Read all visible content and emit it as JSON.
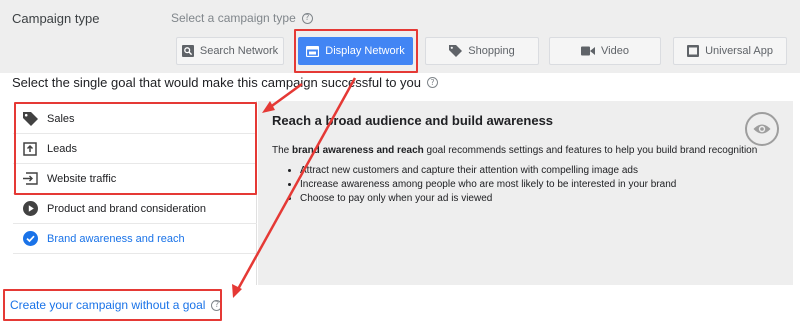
{
  "header": {
    "campaign_type_label": "Campaign type",
    "select_prompt": "Select a campaign type",
    "help_glyph": "?"
  },
  "tabs": [
    {
      "label": "Search Network",
      "icon": "search-icon"
    },
    {
      "label": "Display Network",
      "icon": "display-icon",
      "active": true
    },
    {
      "label": "Shopping",
      "icon": "tag-icon"
    },
    {
      "label": "Video",
      "icon": "video-icon"
    },
    {
      "label": "Universal App",
      "icon": "app-icon"
    }
  ],
  "goal_prompt": "Select the single goal that would make this campaign successful to you",
  "goals": [
    {
      "label": "Sales",
      "icon": "tag-icon"
    },
    {
      "label": "Leads",
      "icon": "leads-icon"
    },
    {
      "label": "Website traffic",
      "icon": "website-traffic-icon"
    },
    {
      "label": "Product and brand consideration",
      "icon": "play-icon"
    },
    {
      "label": "Brand awareness and reach",
      "icon": "check-circle-icon",
      "selected": true
    }
  ],
  "detail": {
    "title": "Reach a broad audience and build awareness",
    "desc_prefix": "The ",
    "desc_bold": "brand awareness and reach",
    "desc_suffix": " goal recommends settings and features to help you build brand recognition",
    "bullets": [
      "Attract new customers and capture their attention with compelling image ads",
      "Increase awareness among people who are most likely to be interested in your brand",
      "Choose to pay only when your ad is viewed"
    ],
    "icon": "eye-icon"
  },
  "no_goal_link": "Create your campaign without a goal",
  "colors": {
    "accent": "#4285f4",
    "link": "#1a73e8",
    "annotation": "#e53935",
    "panel": "#eeeeee"
  }
}
